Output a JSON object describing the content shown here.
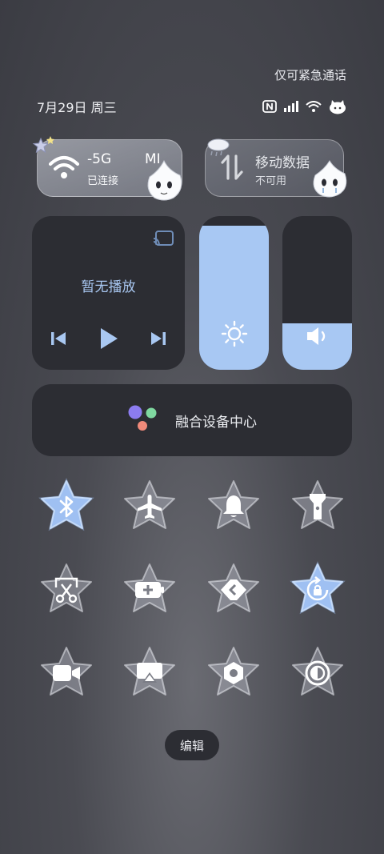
{
  "status": {
    "emergency_text": "仅可紧急通话",
    "date": "7月29日 周三",
    "icons": [
      "nfc-icon",
      "signal-icon",
      "wifi-icon",
      "mascot-icon"
    ]
  },
  "wifi": {
    "title": "-5G",
    "title_suffix": "MI",
    "subtitle": "已连接",
    "icon": "wifi-icon",
    "active": true
  },
  "mobile_data": {
    "title": "移动数据",
    "subtitle": "不可用",
    "icon": "mobile-data-icon",
    "active": false
  },
  "media": {
    "status": "暂无播放",
    "controls": [
      "previous-icon",
      "play-icon",
      "next-icon"
    ],
    "cast_icon": "cast-icon"
  },
  "brightness": {
    "level": 0.94,
    "icon": "sun-icon"
  },
  "volume": {
    "level": 0.3,
    "icon": "speaker-icon"
  },
  "fusion": {
    "label": "融合设备中心",
    "dot_colors": [
      "#8c7cf0",
      "#7fd8a0",
      "#f08a7a"
    ]
  },
  "toggles": [
    {
      "name": "bluetooth",
      "icon": "bluetooth-icon",
      "active": true
    },
    {
      "name": "airplane-mode",
      "icon": "airplane-icon",
      "active": false
    },
    {
      "name": "ring-mode",
      "icon": "bell-icon",
      "active": false
    },
    {
      "name": "flashlight",
      "icon": "flashlight-icon",
      "active": false
    },
    {
      "name": "screenshot",
      "icon": "scissors-icon",
      "active": false
    },
    {
      "name": "battery-saver",
      "icon": "battery-icon",
      "active": false
    },
    {
      "name": "nearby-share",
      "icon": "share-icon",
      "active": false
    },
    {
      "name": "rotation-lock",
      "icon": "rotation-lock-icon",
      "active": true
    },
    {
      "name": "screen-record",
      "icon": "video-icon",
      "active": false
    },
    {
      "name": "screencast",
      "icon": "screencast-icon",
      "active": false
    },
    {
      "name": "settings",
      "icon": "hexagon-icon",
      "active": false
    },
    {
      "name": "dark-mode",
      "icon": "contrast-icon",
      "active": false
    }
  ],
  "colors": {
    "accent": "#a8c8f3",
    "panel": "#2c2d33",
    "active_glow": "#9fc0f2"
  },
  "edit_label": "编辑"
}
